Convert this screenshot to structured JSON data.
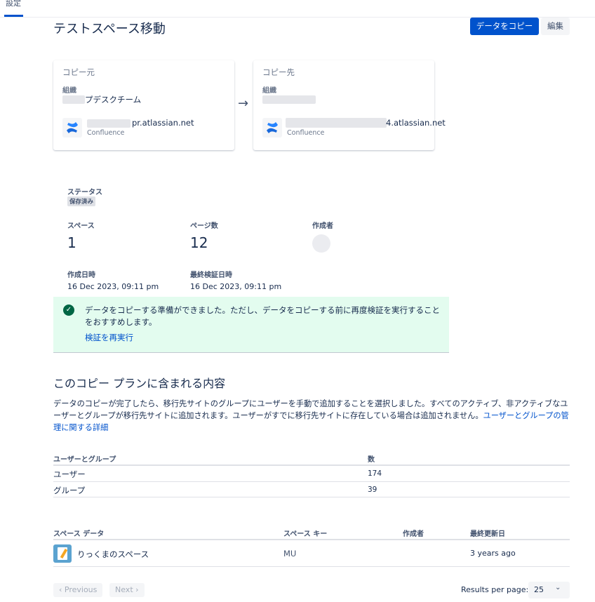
{
  "nav": {
    "tab_settings": "設定"
  },
  "header": {
    "title": "テストスペース移動",
    "copy_button": "データをコピー",
    "edit_button": "編集"
  },
  "source": {
    "title": "コピー元",
    "org_label": "組織",
    "org_name": "プデスクチーム",
    "site": "pr.atlassian.net",
    "product": "Confluence"
  },
  "destination": {
    "title": "コピー先",
    "org_label": "組織",
    "site": "4.atlassian.net",
    "product": "Confluence"
  },
  "status": {
    "label": "ステータス",
    "value": "保存済み"
  },
  "stats": {
    "spaces_label": "スペース",
    "spaces_value": "1",
    "pages_label": "ページ数",
    "pages_value": "12",
    "creator_label": "作成者",
    "created_label": "作成日時",
    "created_value": "16 Dec 2023, 09:11 pm",
    "verified_label": "最終検証日時",
    "verified_value": "16 Dec 2023, 09:11 pm"
  },
  "banner": {
    "message": "データをコピーする準備ができました。ただし、データをコピーする前に再度検証を実行することをおすすめします。",
    "link": "検証を再実行",
    "color": "#e3fcef"
  },
  "plan": {
    "title": "このコピー プランに含まれる内容",
    "description": "データのコピーが完了したら、移行先サイトのグループにユーザーを手動で追加することを選択しました。すべてのアクティブ、非アクティブなユーザーとグループが移行先サイトに追加されます。ユーザーがすでに移行先サイトに存在している場合は追加されません。",
    "description_link": "ユーザーとグループの管理に関する詳細"
  },
  "users_table": {
    "headers": [
      "ユーザーとグループ",
      "数"
    ],
    "rows": [
      {
        "name": "ユーザー",
        "count": "174"
      },
      {
        "name": "グループ",
        "count": "39"
      }
    ]
  },
  "spaces_table": {
    "headers": [
      "スペース データ",
      "スペース キー",
      "作成者",
      "最終更新日"
    ],
    "rows": [
      {
        "name": "りっくまのスペース",
        "key": "MU",
        "creator": "",
        "updated": "3 years ago"
      }
    ]
  },
  "pagination": {
    "previous": "‹  Previous",
    "next": "Next  ›",
    "rpp_label": "Results per page:",
    "rpp_value": "25"
  },
  "colors": {
    "primary": "#0052cc",
    "success": "#006644"
  }
}
